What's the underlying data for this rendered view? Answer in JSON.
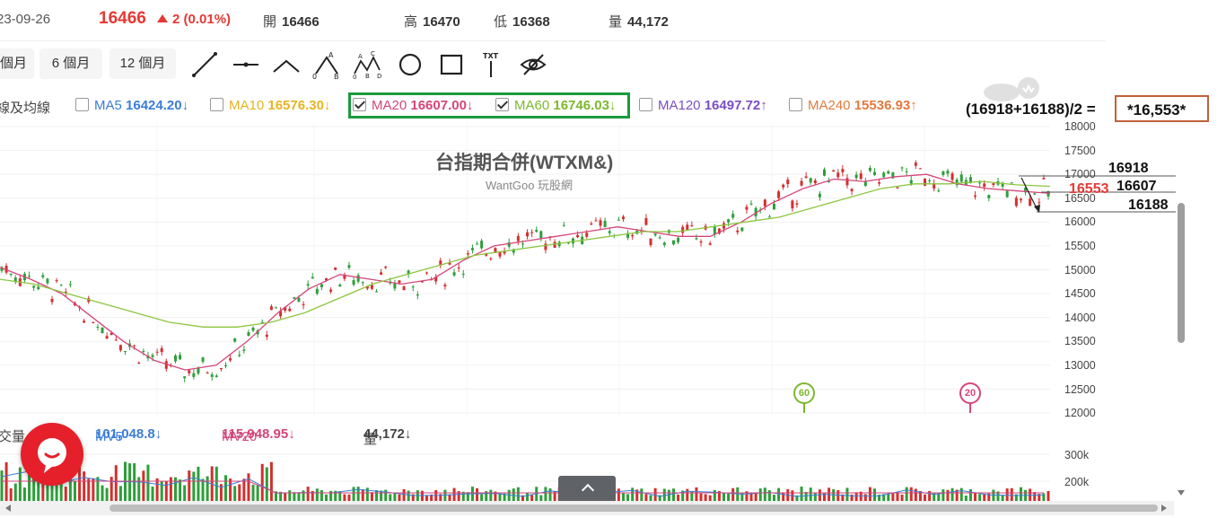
{
  "quote": {
    "date": "23-09-26",
    "price": "16466",
    "change": "2 (0.01%)",
    "open_label": "開",
    "open": "16466",
    "high_label": "高",
    "high": "16470",
    "low_label": "低",
    "low": "16368",
    "volume_label": "量",
    "volume": "44,172"
  },
  "toolbar": {
    "ranges": [
      "個月",
      "6 個月",
      "12 個月"
    ],
    "tools": [
      "line-tool-icon",
      "horizontal-line-tool-icon",
      "angle-tool-icon",
      "abc-pattern-tool-icon",
      "abcd-pattern-tool-icon",
      "circle-tool-icon",
      "rectangle-tool-icon",
      "text-tool-icon",
      "hide-drawings-icon"
    ],
    "abc_labels": [
      "A",
      "0",
      "B"
    ],
    "abcd_labels": [
      "A",
      "C",
      "0",
      "B",
      "D"
    ],
    "text_tool_label": "TXT"
  },
  "ma": {
    "prefix": "線及均線",
    "items": [
      {
        "label": "MA5",
        "value": "16424.20↓",
        "color": "#3b7dd8",
        "checked": false
      },
      {
        "label": "MA10",
        "value": "16576.30↓",
        "color": "#e6b422",
        "checked": false
      },
      {
        "label": "MA20",
        "value": "16607.00↓",
        "color": "#d6457a",
        "checked": true
      },
      {
        "label": "MA60",
        "value": "16746.03↓",
        "color": "#7cb82f",
        "checked": true
      },
      {
        "label": "MA120",
        "value": "16497.72↑",
        "color": "#7a4fc4",
        "checked": false
      },
      {
        "label": "MA240",
        "value": "15536.93↑",
        "color": "#e07a3f",
        "checked": false
      }
    ]
  },
  "formula": {
    "text": "(16918+16188)/2 =",
    "result": "*16,553*"
  },
  "chart": {
    "title": "台指期合併(WTXM&)",
    "subtitle": "WantGoo 玩股網",
    "y_ticks": [
      "18000",
      "17500",
      "17000",
      "16500",
      "16000",
      "15500",
      "15000",
      "14500",
      "14000",
      "13500",
      "13000",
      "12500",
      "12000"
    ],
    "annotations": {
      "high": "16918",
      "mid_red": "16553",
      "mid": "16607",
      "low": "16188"
    },
    "badges": [
      "60",
      "20"
    ]
  },
  "chart_data": {
    "type": "candlestick",
    "title": "台指期合併(WTXM&)",
    "ylim": [
      12000,
      18000
    ],
    "series": [
      {
        "name": "MA20",
        "values": [
          15050,
          14800,
          14500,
          14000,
          13500,
          13100,
          12900,
          13000,
          13500,
          14100,
          14600,
          14900,
          14800,
          14700,
          14800,
          15200,
          15500,
          15600,
          15700,
          15800,
          15900,
          15800,
          15700,
          15700,
          16000,
          16400,
          16700,
          16900,
          16850,
          16950,
          17000,
          16800,
          16700,
          16650,
          16600
        ]
      },
      {
        "name": "MA60",
        "values": [
          14800,
          14700,
          14500,
          14300,
          14100,
          13900,
          13800,
          13800,
          13900,
          14100,
          14400,
          14700,
          14900,
          15100,
          15300,
          15400,
          15500,
          15600,
          15700,
          15800,
          15800,
          15900,
          16000,
          16100,
          16300,
          16500,
          16700,
          16800,
          16800,
          16850,
          16780,
          16750
        ]
      }
    ]
  },
  "volume": {
    "prefix": "交量",
    "items": [
      {
        "label": "MV5",
        "value": "101,048.8↓",
        "color": "#3b7dd8"
      },
      {
        "label": "MV20",
        "value": "115,948.95↓",
        "color": "#d6457a"
      },
      {
        "label": "量",
        "value": "44,172↓",
        "color": "#333333"
      }
    ],
    "y_ticks": [
      "300k",
      "200k"
    ]
  },
  "colors": {
    "up": "#d32f2f",
    "down": "#2e9e3a",
    "accent_box": "#1a9b3c",
    "formula_box": "#c0603a"
  }
}
